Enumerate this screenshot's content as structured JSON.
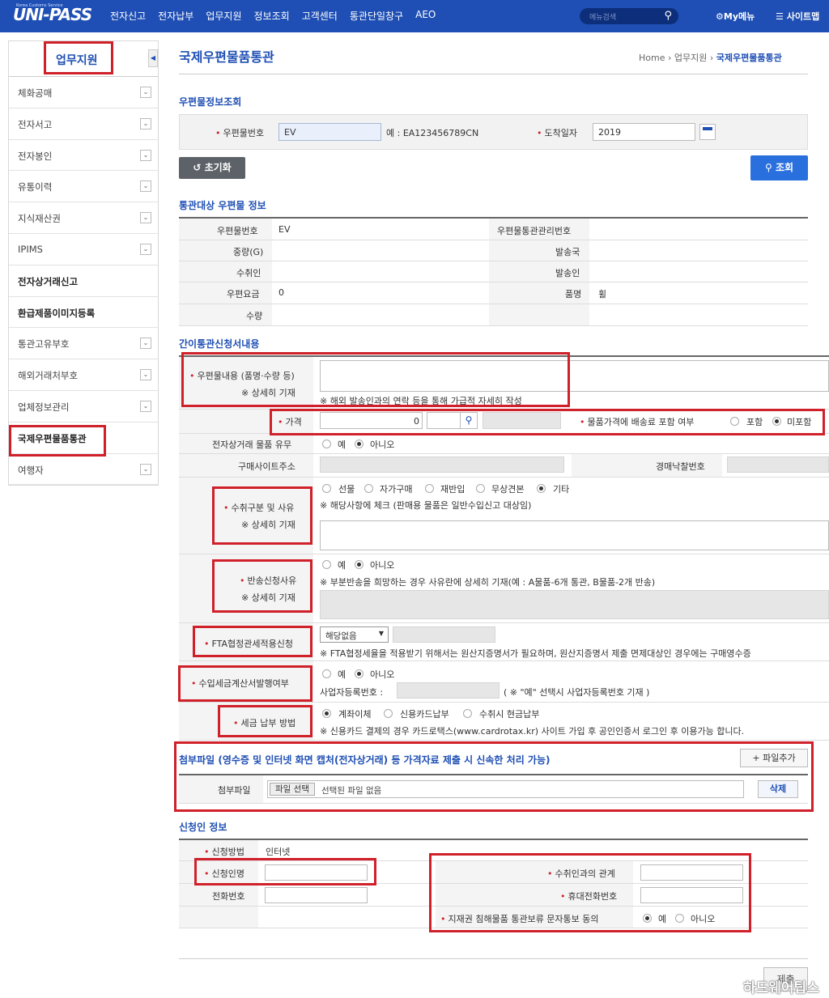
{
  "topbar": {
    "logo": "UNI-PASS",
    "logo_sub": "Korea Customs Service",
    "nav": [
      "전자신고",
      "전자납부",
      "업무지원",
      "정보조회",
      "고객센터",
      "통관단일창구",
      "AEO"
    ],
    "search_placeholder": "메뉴검색",
    "my_menu": "My메뉴",
    "sitemap": "사이트맵"
  },
  "sidebar": {
    "title": "업무지원",
    "items": [
      {
        "label": "체화공매",
        "expandable": true
      },
      {
        "label": "전자서고",
        "expandable": true
      },
      {
        "label": "전자봉인",
        "expandable": true
      },
      {
        "label": "유통이력",
        "expandable": true
      },
      {
        "label": "지식재산권",
        "expandable": true
      },
      {
        "label": "IPIMS",
        "expandable": true
      },
      {
        "label": "전자상거래신고",
        "expandable": false
      },
      {
        "label": "환급제품이미지등록",
        "expandable": false
      },
      {
        "label": "통관고유부호",
        "expandable": true
      },
      {
        "label": "해외거래처부호",
        "expandable": true
      },
      {
        "label": "업체정보관리",
        "expandable": true
      },
      {
        "label": "국제우편물품통관",
        "expandable": false
      },
      {
        "label": "여행자",
        "expandable": true
      }
    ]
  },
  "page": {
    "title": "국제우편물품통관",
    "breadcrumb": [
      "Home",
      "업무지원",
      "국제우편물품통관"
    ]
  },
  "postal_query": {
    "heading": "우편물정보조회",
    "postal_no_label": "우편물번호",
    "postal_no_value": "EV",
    "example": "예 : EA123456789CN",
    "arrival_label": "도착일자",
    "arrival_value": "2019",
    "reset_label": "초기화",
    "search_label": "조회"
  },
  "target_info": {
    "heading": "통관대상 우편물 정보",
    "rows": [
      {
        "l1": "우편물번호",
        "v1": "EV",
        "l2": "우편물통관관리번호",
        "v2": ""
      },
      {
        "l1": "중량(G)",
        "v1": "",
        "l2": "발송국",
        "v2": ""
      },
      {
        "l1": "수취인",
        "v1": "",
        "l2": "발송인",
        "v2": ""
      },
      {
        "l1": "우편요금",
        "v1": "0",
        "l2": "품명",
        "v2": "휠"
      },
      {
        "l1": "수량",
        "v1": "",
        "l2": "",
        "v2": ""
      }
    ]
  },
  "application": {
    "heading": "간이통관신청서내용",
    "contents_label": "우편물내용 (품명·수량 등)",
    "contents_sub": "※ 상세히 기재",
    "contents_note": "※ 해외 발송인과의 연락 등을 통해 가급적 자세히 작성",
    "price_label": "가격",
    "price_value": "0",
    "shipping_label": "물품가격에 배송료 포함 여부",
    "shipping_opts": [
      "포함",
      "미포함"
    ],
    "ecommerce_label": "전자상거래 물품 유무",
    "yes": "예",
    "no": "아니오",
    "site_label": "구매사이트주소",
    "bid_label": "경매낙찰번호",
    "receipt_label": "수취구분 및 사유",
    "receipt_sub": "※ 상세히 기재",
    "receipt_opts": [
      "선물",
      "자가구매",
      "재반입",
      "무상견본",
      "기타"
    ],
    "receipt_note": "※ 해당사항에 체크 (판매용 물품은 일반수입신고 대상임)",
    "return_label": "반송신청사유",
    "return_sub": "※ 상세히 기재",
    "return_note": "※ 부분반송을 희망하는 경우 사유란에 상세히 기재(예 : A물품-6개 통관, B물품-2개 반송)",
    "fta_label": "FTA협정관세적용신청",
    "fta_select": "해당없음",
    "fta_note": "※ FTA협정세율을 적용받기 위해서는 원산지증명서가 필요하며, 원산지증명서 제출 면제대상인 경우에는 구매영수증",
    "invoice_label": "수입세금계산서발행여부",
    "biz_no_label": "사업자등록번호 :",
    "biz_note": "( ※ \"예\" 선택시 사업자등록번호 기재 )",
    "tax_label": "세금 납부 방법",
    "tax_opts": [
      "계좌이체",
      "신용카드납부",
      "수취시 현금납부"
    ],
    "tax_note": "※ 신용카드 결제의 경우 카드로택스(www.cardrotax.kr) 사이트 가입 후 공인인증서 로그인 후 이용가능 합니다."
  },
  "attach": {
    "heading": "첨부파일 (영수증 및 인터넷 화면 캡처(전자상거래) 등 가격자료 제출 시 신속한 처리 가능)",
    "add_label": "+ 파일추가",
    "file_label": "첨부파일",
    "pick_label": "파일 선택",
    "none_label": "선택된 파일 없음",
    "delete_label": "삭제"
  },
  "applicant": {
    "heading": "신청인 정보",
    "method_label": "신청방법",
    "method_value": "인터넷",
    "name_label": "신청인명",
    "phone_label": "전화번호",
    "relation_label": "수취인과의 관계",
    "mobile_label": "휴대전화번호",
    "consent_label": "지재권 침해물품 통관보류 문자통보 동의",
    "yes": "예",
    "no": "아니오"
  },
  "footer": {
    "submit_label": "제출",
    "watermark": "하드웨어팁스"
  },
  "colors": {
    "brand": "#1f4fb4",
    "highlight": "#d0202a",
    "primary_button": "#2a6fde"
  }
}
